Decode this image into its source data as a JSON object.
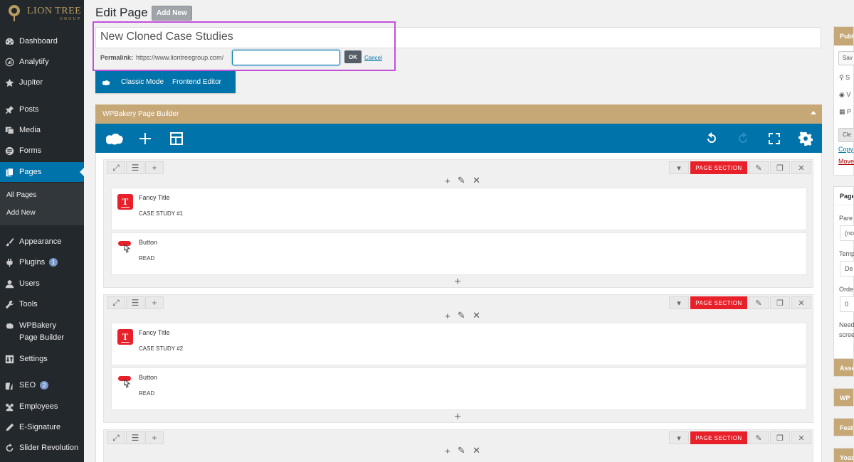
{
  "logo": {
    "brand": "LION TREE",
    "sub": "GROUP"
  },
  "sidebar": {
    "items": [
      {
        "label": "Dashboard",
        "icon": "dashboard-icon"
      },
      {
        "label": "Analytify",
        "icon": "analytify-icon"
      },
      {
        "label": "Jupiter",
        "icon": "star-icon"
      },
      {
        "label": "Posts",
        "icon": "pin-icon"
      },
      {
        "label": "Media",
        "icon": "media-icon"
      },
      {
        "label": "Forms",
        "icon": "forms-icon"
      },
      {
        "label": "Pages",
        "icon": "pages-icon"
      },
      {
        "label": "Appearance",
        "icon": "paintbrush-icon"
      },
      {
        "label": "Plugins",
        "icon": "plugin-icon",
        "count": "1"
      },
      {
        "label": "Users",
        "icon": "users-icon"
      },
      {
        "label": "Tools",
        "icon": "wrench-icon"
      },
      {
        "label": "WPBakery Page Builder",
        "icon": "wpbakery-icon"
      },
      {
        "label": "Settings",
        "icon": "settings-icon"
      },
      {
        "label": "SEO",
        "icon": "yoast-icon",
        "count": "2"
      },
      {
        "label": "Employees",
        "icon": "employees-icon"
      },
      {
        "label": "E-Signature",
        "icon": "pen-icon"
      },
      {
        "label": "Slider Revolution",
        "icon": "refresh-icon"
      }
    ],
    "submenu": [
      "All Pages",
      "Add New"
    ]
  },
  "header": {
    "title": "Edit Page",
    "add_new": "Add New"
  },
  "post": {
    "title": "New Cloned Case Studies",
    "permalink_label": "Permalink:",
    "permalink_base": "https://www.liontreegroup.com/",
    "slug_value": "",
    "ok": "OK",
    "cancel": "Cancel"
  },
  "mode_bar": {
    "classic": "Classic Mode",
    "frontend": "Frontend Editor"
  },
  "wpbakery": {
    "title": "WPBakery Page Builder",
    "section_tag": "PAGE SECTION",
    "sections": [
      {
        "elements": [
          {
            "name": "Fancy Title",
            "value": "CASE STUDY #1",
            "type": "fancy-title"
          },
          {
            "name": "Button",
            "value": "READ",
            "type": "button"
          }
        ]
      },
      {
        "elements": [
          {
            "name": "Fancy Title",
            "value": "CASE STUDY #2",
            "type": "fancy-title"
          },
          {
            "name": "Button",
            "value": "READ",
            "type": "button"
          }
        ]
      },
      {
        "elements": []
      }
    ]
  },
  "right_panel": {
    "publish": {
      "title": "Publi",
      "save": "Sav",
      "clear": "Cle",
      "copy": "Copy",
      "move": "Move",
      "rows": [
        "S",
        "V",
        "P"
      ]
    },
    "page_attributes": {
      "title": "Page",
      "parent_label": "Pare",
      "parent_value": "(no",
      "template_label": "Temp",
      "template_value": "De",
      "order_label": "Orde",
      "order_value": "0",
      "help1": "Need",
      "help2": "scree"
    },
    "collapsed": [
      "Asse",
      "WP",
      "Feat",
      "Yoas"
    ]
  },
  "colors": {
    "accent": "#0073aa",
    "builder_header": "#c6a877",
    "section_tag": "#e8202a",
    "highlight": "#c34fd9",
    "sidebar": "#23282d"
  }
}
